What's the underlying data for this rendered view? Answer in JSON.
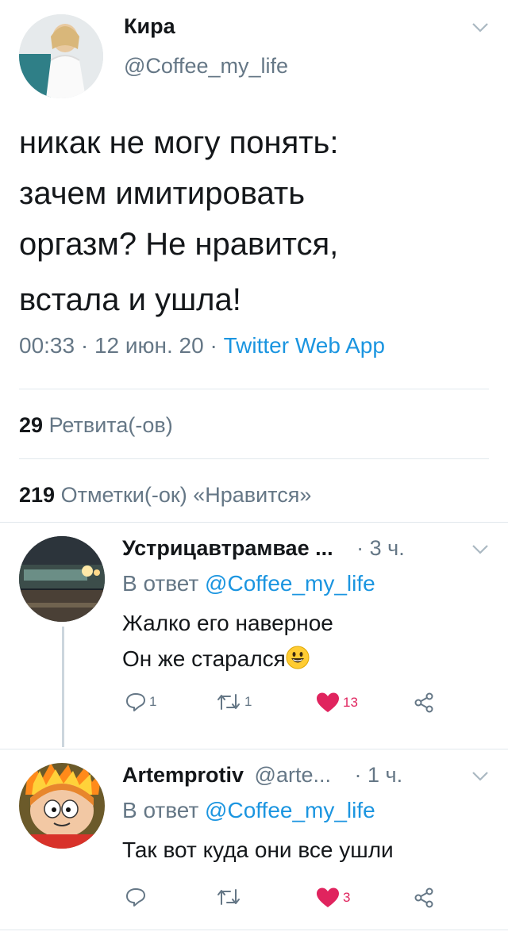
{
  "author": {
    "name": "Кира",
    "handle": "@Coffee_my_life"
  },
  "tweet": {
    "lines": [
      "никак не могу понять:",
      "зачем имитировать",
      "оргазм? Не нравится,",
      "встала и ушла!"
    ],
    "time": "00:33",
    "date": "12 июн. 20",
    "sep": "·",
    "source": "Twitter Web App"
  },
  "stats": {
    "retweets_count": "29",
    "retweets_label": "Ретвита(-ов)",
    "likes_count": "219",
    "likes_label": "Отметки(-ок) «Нравится»"
  },
  "replies": [
    {
      "name": "Устрицавтрамвае ...",
      "handle": "",
      "time": "· 3 ч.",
      "reply_prefix": "В ответ",
      "reply_to": "@Coffee_my_life",
      "lines": [
        "Жалко его наверное",
        "Он же старался"
      ],
      "emoji": "grinning-face",
      "reply_count": "1",
      "retweet_count": "1",
      "like_count": "13"
    },
    {
      "name": "Artemprotiv",
      "handle": "@arte...",
      "time": "· 1 ч.",
      "reply_prefix": "В ответ",
      "reply_to": "@Coffee_my_life",
      "lines": [
        "Так вот куда они все ушли"
      ],
      "reply_count": "",
      "retweet_count": "",
      "like_count": "3"
    }
  ],
  "colors": {
    "text": "#14171a",
    "muted": "#657786",
    "link": "#1b95e0",
    "like": "#e0245e",
    "divider": "#e1e8ed"
  }
}
